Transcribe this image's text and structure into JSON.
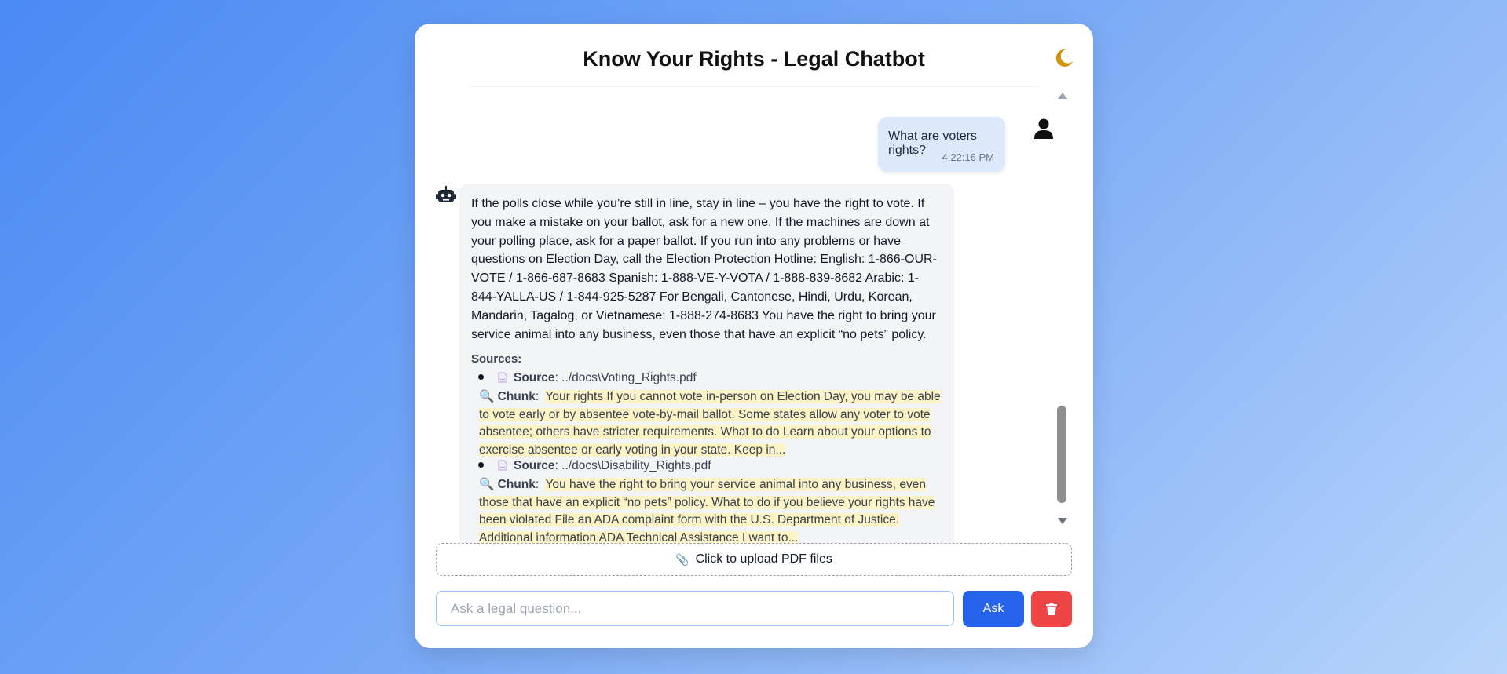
{
  "app": {
    "title": "Know Your Rights - Legal Chatbot"
  },
  "messages": {
    "user": {
      "text": "What are voters rights?",
      "time": "4:22:16 PM"
    },
    "bot": {
      "text": "If the polls close while you’re still in line, stay in line – you have the right to vote. If you make a mistake on your ballot, ask for a new one. If the machines are down at your polling place, ask for a paper ballot. If you run into any problems or have questions on Election Day, call the Election Protection Hotline: English: 1-866-OUR-VOTE / 1-866-687-8683 Spanish: 1-888-VE-Y-VOTA / 1-888-839-8682 Arabic: 1-844-YALLA-US / 1-844-925-5287 For Bengali, Cantonese, Hindi, Urdu, Korean, Mandarin, Tagalog, or Vietnamese: 1-888-274-8683 You have the right to bring your service animal into any business, even those that have an explicit “no pets” policy.",
      "sources_label": "Sources:",
      "source_key": "Source",
      "chunk_key": "Chunk",
      "sources": [
        {
          "path": ": ../docs\\Voting_Rights.pdf",
          "chunk": "Your rights If you cannot vote in-person on Election Day, you may be able to vote early or by absentee vote-by-mail ballot. Some states allow any voter to vote absentee; others have stricter requirements. What to do Learn about your options to exercise absentee or early voting in your state. Keep in..."
        },
        {
          "path": ": ../docs\\Disability_Rights.pdf",
          "chunk": "You have the right to bring your service animal into any business, even those that have an explicit “no pets” policy.   What to do if you believe your rights have been violated File an ADA complaint form with the U.S. Department of Justice.  Additional information ADA Technical Assistance I want to..."
        }
      ]
    }
  },
  "upload": {
    "label": "Click to upload PDF files",
    "icon": "paperclip-icon"
  },
  "input": {
    "placeholder": "Ask a legal question...",
    "value": ""
  },
  "buttons": {
    "ask": "Ask",
    "clear_icon": "trash-icon"
  },
  "colors": {
    "accent": "#2563eb",
    "danger": "#ef4444",
    "user_bubble": "#dce8fb",
    "bot_bubble": "#f3f4f6",
    "highlight": "#fdf3c4",
    "moon": "#d4920b"
  }
}
